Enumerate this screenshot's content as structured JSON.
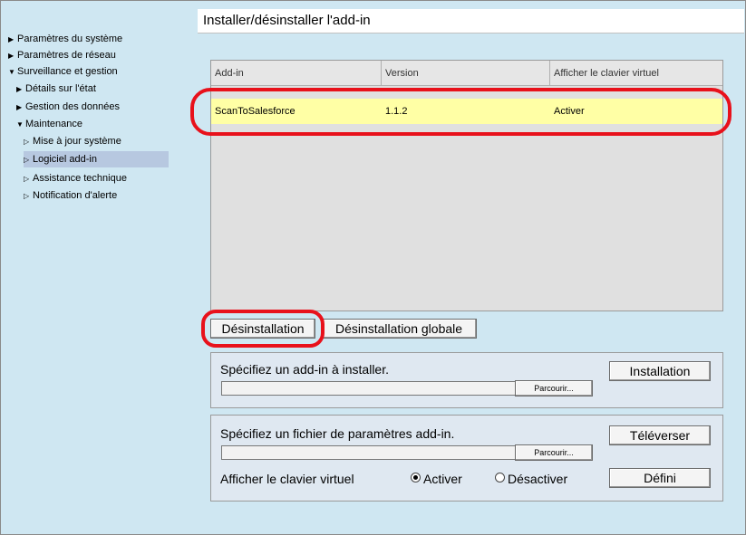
{
  "sidebar": {
    "items": [
      {
        "label": "Paramètres du système",
        "tri": "▶"
      },
      {
        "label": "Paramètres de réseau",
        "tri": "▶"
      },
      {
        "label": "Surveillance et gestion",
        "tri": "▼"
      },
      {
        "label": "Détails sur l'état",
        "tri": "▶"
      },
      {
        "label": "Gestion des données",
        "tri": "▶"
      },
      {
        "label": "Maintenance",
        "tri": "▼"
      },
      {
        "label": "Mise à jour système",
        "tri": "▷"
      },
      {
        "label": "Logiciel add-in",
        "tri": "▷"
      },
      {
        "label": "Assistance technique",
        "tri": "▷"
      },
      {
        "label": "Notification d'alerte",
        "tri": "▷"
      }
    ]
  },
  "page": {
    "title": "Installer/désinstaller l'add-in"
  },
  "table": {
    "headers": [
      "Add-in",
      "Version",
      "Afficher le clavier virtuel"
    ],
    "rows": [
      [
        "ScanToSalesforce",
        "1.1.2",
        "Activer"
      ]
    ]
  },
  "buttons": {
    "uninstall": "Désinstallation",
    "uninstall_all": "Désinstallation globale",
    "install": "Installation",
    "browse": "Parcourir...",
    "upload": "Téléverser",
    "set": "Défini"
  },
  "install_panel": {
    "label": "Spécifiez un add-in à installer."
  },
  "settings_panel": {
    "label": "Spécifiez un fichier de paramètres add-in.",
    "keyboard_label": "Afficher le clavier virtuel",
    "enable": "Activer",
    "disable": "Désactiver"
  },
  "colors": {
    "highlight_ring": "#e8111b",
    "selected_row": "#ffffa5",
    "background": "#cfe7f2"
  }
}
